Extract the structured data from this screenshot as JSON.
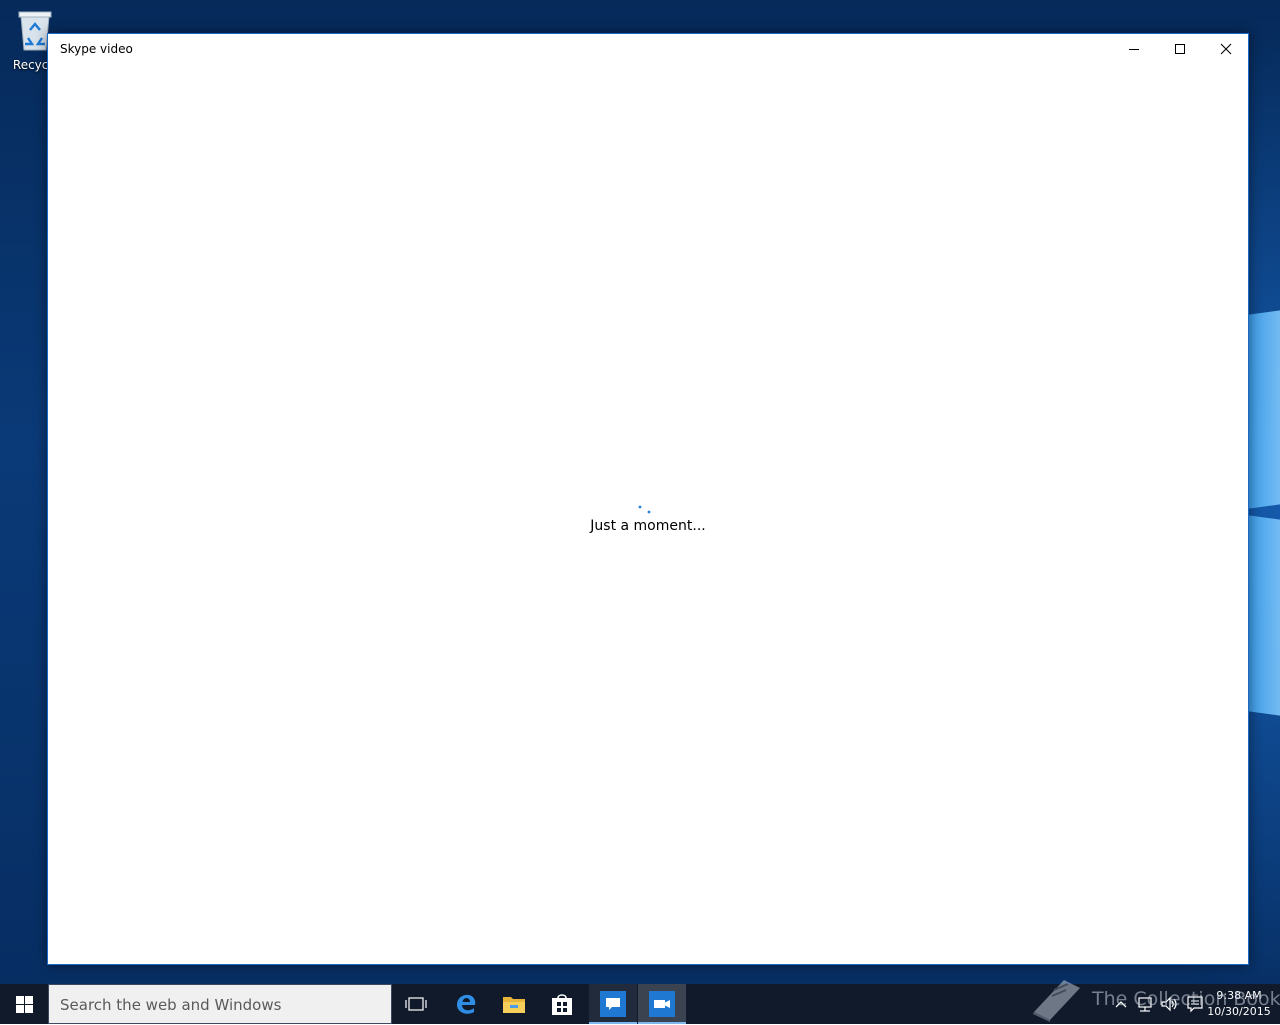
{
  "desktop": {
    "recycle_bin_label": "Recycle"
  },
  "window": {
    "title": "Skype video",
    "loading_text": "Just a moment...",
    "icons": {
      "minimize": "minimize-icon",
      "maximize": "maximize-icon",
      "close": "close-icon"
    }
  },
  "taskbar": {
    "search_placeholder": "Search the web and Windows",
    "pinned": [
      "task-view",
      "edge",
      "file-explorer",
      "store",
      "messaging",
      "skype-video"
    ],
    "time": "9:38 AM",
    "date": "10/30/2015"
  },
  "watermark": {
    "text": "The Collection Book"
  },
  "colors": {
    "accent": "#1a6bc7",
    "taskbar": "#101a2b",
    "spinner": "#2a7fd4"
  }
}
